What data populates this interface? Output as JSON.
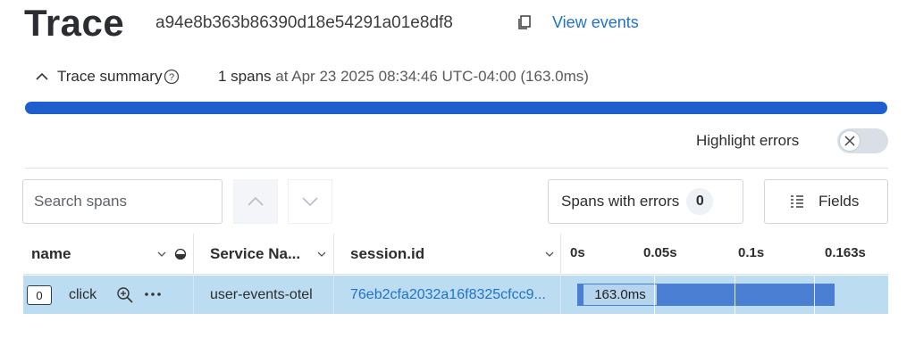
{
  "header": {
    "title": "Trace",
    "trace_id": "a94e8b363b86390d18e54291a01e8df8",
    "view_events": "View events"
  },
  "summary": {
    "label": "Trace summary",
    "span_count": "1 spans",
    "at_word": "at",
    "timestamp": "Apr 23 2025 08:34:46 UTC-04:00",
    "duration": "(163.0ms)",
    "overview_progress": 1.0
  },
  "highlight_errors": {
    "label": "Highlight errors",
    "enabled": false
  },
  "toolbar": {
    "search_placeholder": "Search spans",
    "errors_label": "Spans with errors",
    "errors_count": "0",
    "fields_label": "Fields"
  },
  "table": {
    "columns": {
      "name": "name",
      "service": "Service Na...",
      "session": "session.id"
    },
    "timeline_ticks": [
      "0s",
      "0.05s",
      "0.1s",
      "0.163s"
    ],
    "rows": [
      {
        "index": "0",
        "name": "click",
        "service": "user-events-otel",
        "session_id": "76eb2cfa2032a16f8325cfcc9...",
        "duration_label": "163.0ms"
      }
    ]
  },
  "colors": {
    "accent": "#1f5fcd",
    "link": "#1f73c9",
    "row_selected": "#bcdcf2",
    "span_bar": "#4a7fd3"
  },
  "icons": [
    "copy-icon",
    "chevron-up-icon",
    "help-icon",
    "close-icon",
    "chevron-down-icon",
    "fields-icon",
    "zoom-in-icon",
    "more-icon",
    "sort-chevron-icon",
    "half-circle-icon"
  ]
}
